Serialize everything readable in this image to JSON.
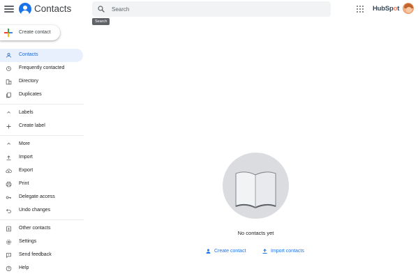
{
  "header": {
    "app_title": "Contacts",
    "search_placeholder": "Search",
    "search_tooltip": "Search",
    "brand": {
      "text_main": "HubSp",
      "text_dot": "o",
      "text_end": "t"
    }
  },
  "sidebar": {
    "create_contact": "Create contact",
    "nav": [
      {
        "label": "Contacts",
        "icon": "person-icon",
        "active": true
      },
      {
        "label": "Frequently contacted",
        "icon": "history-icon"
      },
      {
        "label": "Directory",
        "icon": "domain-icon"
      },
      {
        "label": "Duplicates",
        "icon": "copy-icon"
      }
    ],
    "labels_section": "Labels",
    "create_label": "Create label",
    "more_section": "More",
    "more_items": [
      {
        "label": "Import",
        "icon": "upload-icon"
      },
      {
        "label": "Export",
        "icon": "cloud-upload-icon"
      },
      {
        "label": "Print",
        "icon": "print-icon"
      },
      {
        "label": "Delegate access",
        "icon": "key-icon"
      },
      {
        "label": "Undo changes",
        "icon": "undo-icon"
      }
    ],
    "bottom_items": [
      {
        "label": "Other contacts",
        "icon": "other-contacts-icon"
      },
      {
        "label": "Settings",
        "icon": "gear-icon"
      },
      {
        "label": "Send feedback",
        "icon": "feedback-icon"
      },
      {
        "label": "Help",
        "icon": "help-icon"
      }
    ]
  },
  "main": {
    "empty_message": "No contacts yet",
    "create_contact_link": "Create contact",
    "import_contacts_link": "Import contacts"
  },
  "colors": {
    "accent": "#1a73e8",
    "active_bg": "#e8f0fe",
    "brand_orange": "#ff7a59"
  }
}
